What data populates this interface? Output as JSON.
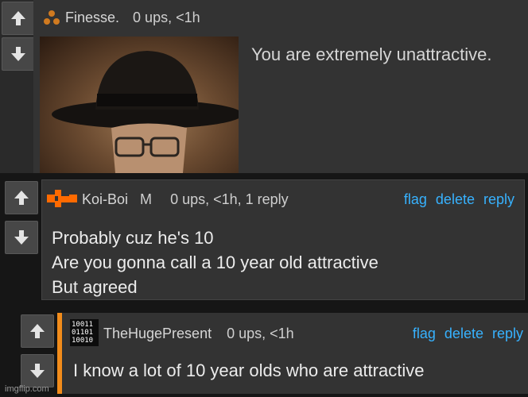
{
  "comments": [
    {
      "user": "Finesse.",
      "gender": "",
      "stats": "0 ups, <1h",
      "text": "You are extremely unattractive.",
      "image_alt": "man in fedora and glasses"
    },
    {
      "user": "Koi-Boi",
      "gender": "M",
      "stats": "0 ups, <1h, 1 reply",
      "lines": [
        "Probably cuz he's 10",
        "Are you gonna call a 10 year old attractive",
        "But agreed"
      ],
      "actions": {
        "flag": "flag",
        "delete": "delete",
        "reply": "reply"
      }
    },
    {
      "user": "TheHugePresent",
      "stats": "0 ups, <1h",
      "text": "I know a lot of 10 year olds who are attractive",
      "actions": {
        "flag": "flag",
        "delete": "delete",
        "reply": "reply"
      },
      "avatar_text": [
        "10011",
        "01101",
        "10010"
      ]
    }
  ],
  "watermark": "imgflip.com",
  "colors": {
    "link": "#37b2ff",
    "panel": "#2e2e2e",
    "accent": "#f28c1b"
  }
}
